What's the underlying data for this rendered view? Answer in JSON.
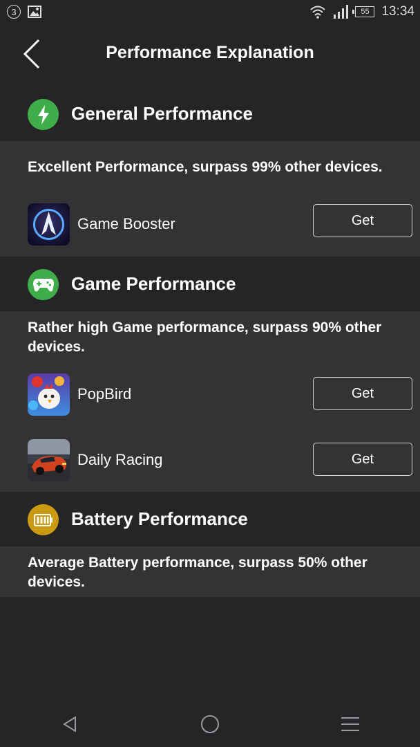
{
  "status_bar": {
    "notification_count": "3",
    "battery": "55",
    "time": "13:34"
  },
  "header": {
    "title": "Performance Explanation"
  },
  "sections": [
    {
      "title": "General Performance",
      "icon": "lightning-icon",
      "icon_color": "#3fae4a",
      "description": "Excellent Performance, surpass 99% other devices.",
      "apps": [
        {
          "name": "Game Booster",
          "action": "Get"
        }
      ]
    },
    {
      "title": "Game Performance",
      "icon": "gamepad-icon",
      "icon_color": "#3fae4a",
      "description": "Rather high Game performance, surpass 90% other devices.",
      "apps": [
        {
          "name": "PopBird",
          "action": "Get"
        },
        {
          "name": "Daily Racing",
          "action": "Get"
        }
      ]
    },
    {
      "title": "Battery Performance",
      "icon": "battery-icon",
      "icon_color": "#c99a12",
      "description": "Average Battery performance, surpass 50% other devices."
    }
  ]
}
